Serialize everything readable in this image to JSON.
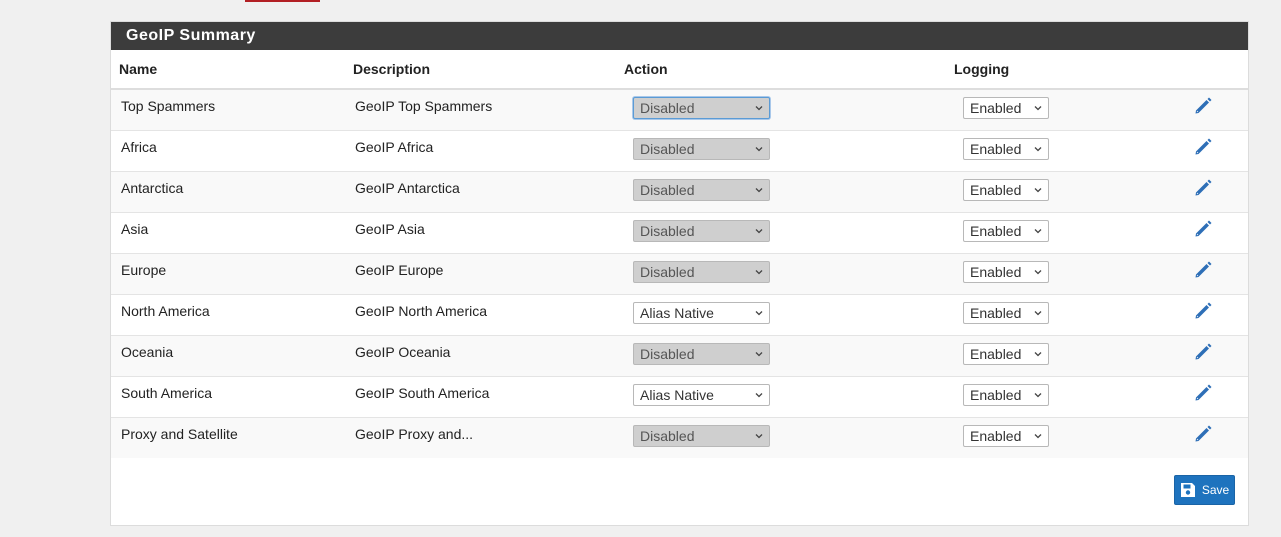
{
  "panel": {
    "title": "GeoIP Summary"
  },
  "table": {
    "columns": {
      "name": "Name",
      "description": "Description",
      "action": "Action",
      "logging": "Logging"
    },
    "rows": [
      {
        "name": "Top Spammers",
        "description": "GeoIP Top Spammers",
        "action": "Disabled",
        "action_disabled": true,
        "logging": "Enabled"
      },
      {
        "name": "Africa",
        "description": "GeoIP Africa",
        "action": "Disabled",
        "action_disabled": true,
        "logging": "Enabled"
      },
      {
        "name": "Antarctica",
        "description": "GeoIP Antarctica",
        "action": "Disabled",
        "action_disabled": true,
        "logging": "Enabled"
      },
      {
        "name": "Asia",
        "description": "GeoIP Asia",
        "action": "Disabled",
        "action_disabled": true,
        "logging": "Enabled"
      },
      {
        "name": "Europe",
        "description": "GeoIP Europe",
        "action": "Disabled",
        "action_disabled": true,
        "logging": "Enabled"
      },
      {
        "name": "North America",
        "description": "GeoIP North America",
        "action": "Alias Native",
        "action_disabled": false,
        "logging": "Enabled"
      },
      {
        "name": "Oceania",
        "description": "GeoIP Oceania",
        "action": "Disabled",
        "action_disabled": true,
        "logging": "Enabled"
      },
      {
        "name": "South America",
        "description": "GeoIP South America",
        "action": "Alias Native",
        "action_disabled": false,
        "logging": "Enabled"
      },
      {
        "name": "Proxy and Satellite",
        "description": "GeoIP Proxy and...",
        "action": "Disabled",
        "action_disabled": true,
        "logging": "Enabled"
      }
    ]
  },
  "buttons": {
    "save_label": "Save"
  },
  "icons": {
    "edit": "pencil-icon",
    "save": "floppy-disk-icon",
    "dropdown": "chevron-down-icon"
  },
  "colors": {
    "heading_bg": "#3c3c3c",
    "accent_blue": "#1e73be",
    "disabled_select_bg": "#cfcfcf",
    "top_accent": "#b21f24"
  }
}
